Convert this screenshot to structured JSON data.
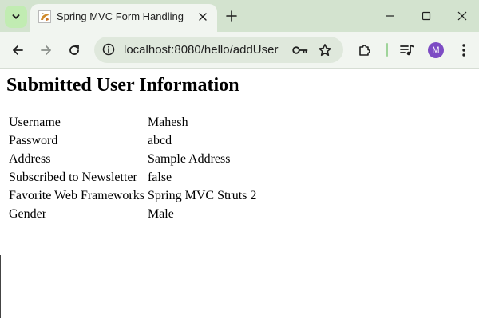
{
  "browser": {
    "tab": {
      "title": "Spring MVC Form Handling"
    },
    "address_bar": {
      "url": "localhost:8080/hello/addUser"
    },
    "profile": {
      "initial": "M",
      "color": "#7d4cc4"
    },
    "colors": {
      "tabstrip": "#d3e3cf",
      "toolbar": "#f1f5f0",
      "tab_search": "#c1ecb2"
    }
  },
  "page": {
    "heading": "Submitted User Information",
    "rows": [
      {
        "label": "Username",
        "value": "Mahesh"
      },
      {
        "label": "Password",
        "value": "abcd"
      },
      {
        "label": "Address",
        "value": "Sample Address"
      },
      {
        "label": "Subscribed to Newsletter",
        "value": "false"
      },
      {
        "label": "Favorite Web Frameworks",
        "value": "Spring MVC Struts 2"
      },
      {
        "label": "Gender",
        "value": "Male"
      }
    ]
  }
}
